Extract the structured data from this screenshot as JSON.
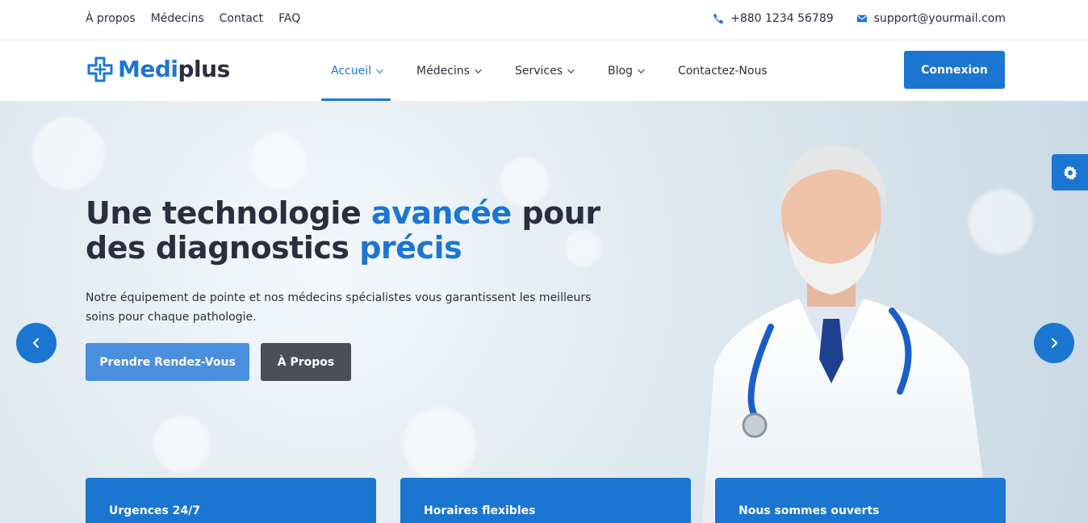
{
  "topbar": {
    "links": [
      "À propos",
      "Médecins",
      "Contact",
      "FAQ"
    ],
    "phone": "+880 1234 56789",
    "email": "support@yourmail.com"
  },
  "header": {
    "logo_part1": "Medi",
    "logo_part2": "plus",
    "nav": [
      {
        "label": "Accueil",
        "active": true,
        "dropdown": true
      },
      {
        "label": "Médecins",
        "active": false,
        "dropdown": true
      },
      {
        "label": "Services",
        "active": false,
        "dropdown": true
      },
      {
        "label": "Blog",
        "active": false,
        "dropdown": true
      },
      {
        "label": "Contactez-Nous",
        "active": false,
        "dropdown": false
      }
    ],
    "login_label": "Connexion"
  },
  "hero": {
    "title_part1": "Une technologie ",
    "title_hl1": "avancée",
    "title_part2": " pour des diagnostics ",
    "title_hl2": "précis",
    "description": "Notre équipement de pointe et nos médecins spécialistes vous garantissent les meilleurs soins pour chaque pathologie.",
    "primary_button": "Prendre Rendez-Vous",
    "secondary_button": "À Propos"
  },
  "features": [
    "Urgences 24/7",
    "Horaires flexibles",
    "Nous sommes ouverts"
  ],
  "icons": {
    "phone": "phone-icon",
    "email": "envelope-icon",
    "logo": "medical-cross-icon",
    "settings": "gear-icon",
    "prev": "chevron-left-icon",
    "next": "chevron-right-icon"
  },
  "colors": {
    "accent": "#1a76d1",
    "text": "#2c2d3f",
    "secondary_button": "#4c4e5a"
  }
}
